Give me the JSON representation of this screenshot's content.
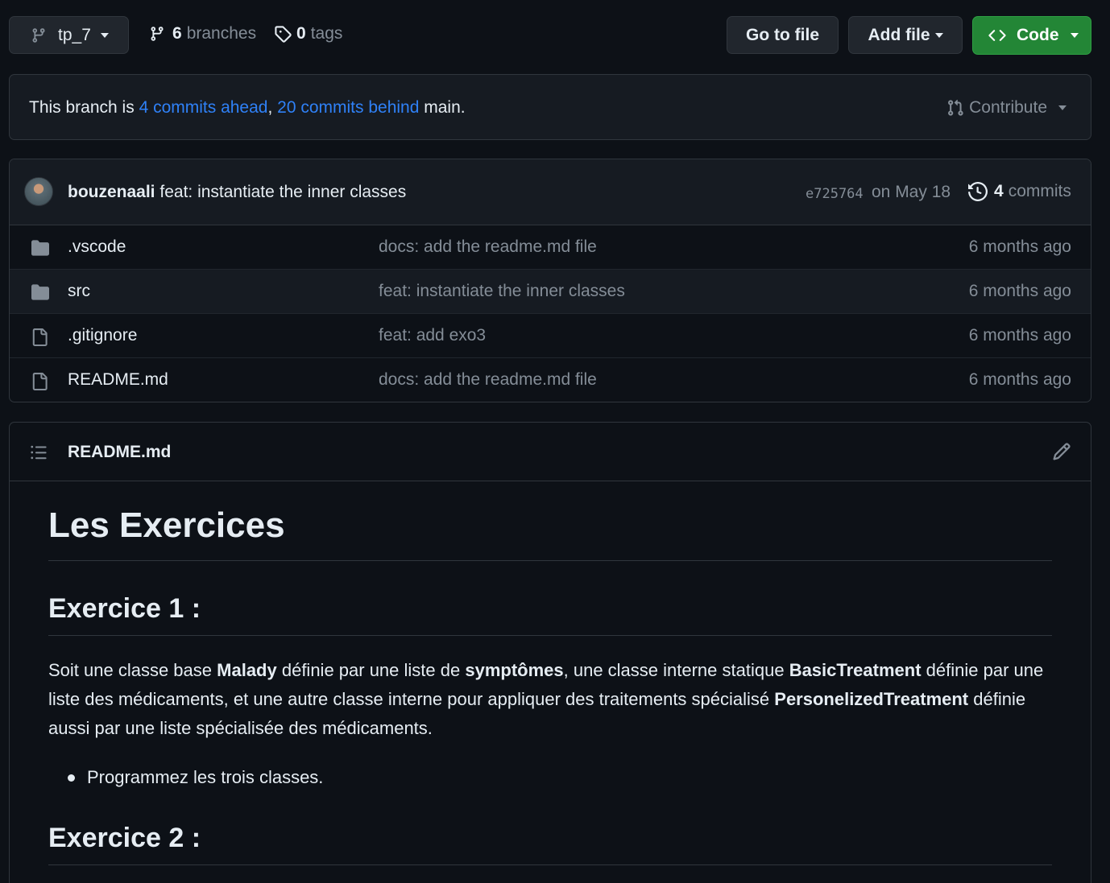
{
  "toolbar": {
    "branch_name": "tp_7",
    "branches_count": "6",
    "branches_label": "branches",
    "tags_count": "0",
    "tags_label": "tags",
    "go_to_file": "Go to file",
    "add_file": "Add file",
    "code": "Code"
  },
  "branch_status": {
    "prefix": "This branch is ",
    "ahead": "4 commits ahead",
    "sep": ", ",
    "behind": "20 commits behind",
    "suffix": " main.",
    "contribute": "Contribute"
  },
  "latest_commit": {
    "author": "bouzenaali",
    "message": "feat: instantiate the inner classes",
    "hash": "e725764",
    "date": "on May 18",
    "commits_count": "4",
    "commits_label": "commits"
  },
  "files": [
    {
      "name": ".vscode",
      "type": "folder",
      "message": "docs: add the readme.md file",
      "age": "6 months ago"
    },
    {
      "name": "src",
      "type": "folder",
      "message": "feat: instantiate the inner classes",
      "age": "6 months ago"
    },
    {
      "name": ".gitignore",
      "type": "file",
      "message": "feat: add exo3",
      "age": "6 months ago"
    },
    {
      "name": "README.md",
      "type": "file",
      "message": "docs: add the readme.md file",
      "age": "6 months ago"
    }
  ],
  "readme": {
    "filename": "README.md",
    "h1": "Les Exercices",
    "ex1_title": "Exercice 1 :",
    "p1": {
      "t1": "Soit une classe base ",
      "b1": "Malady",
      "t2": " définie par une liste de ",
      "b2": "symptômes",
      "t3": ", une classe interne statique ",
      "b3": "BasicTreatment",
      "t4": " définie par une liste des médicaments, et une autre classe interne pour appliquer des traitements spécialisé ",
      "b4": "PersonelizedTreatment",
      "t5": " définie aussi par une liste spécialisée des médicaments."
    },
    "bullet1": "Programmez les trois classes.",
    "ex2_title": "Exercice 2 :"
  },
  "colors": {
    "background": "#0d1117",
    "border": "#30363d",
    "link": "#2f81f7",
    "code_button": "#238636",
    "muted": "#848d97"
  }
}
